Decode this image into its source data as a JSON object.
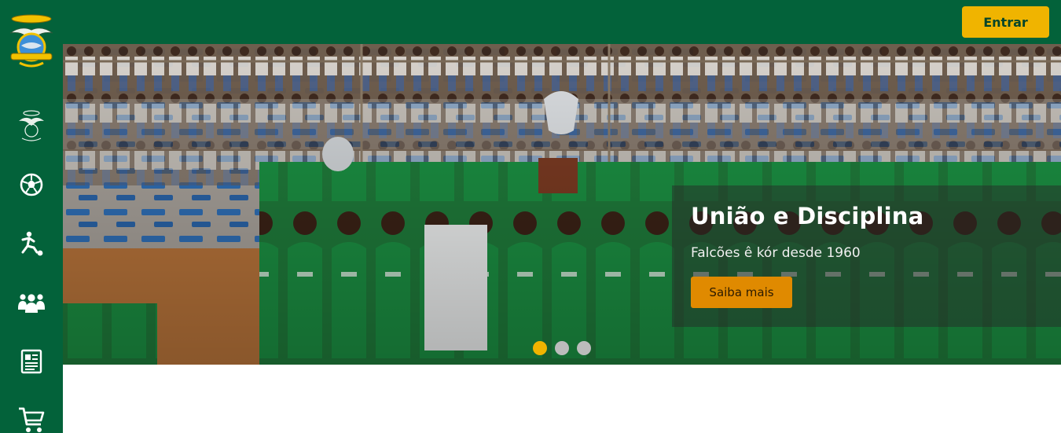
{
  "header": {
    "login_label": "Entrar"
  },
  "sidebar": {
    "logo_icon": "club-crest-icon",
    "items": [
      {
        "name": "club",
        "icon": "club-emblem-icon"
      },
      {
        "name": "football",
        "icon": "soccer-ball-icon"
      },
      {
        "name": "sports",
        "icon": "player-kick-icon"
      },
      {
        "name": "members",
        "icon": "group-people-icon"
      },
      {
        "name": "news",
        "icon": "newspaper-icon"
      },
      {
        "name": "shop",
        "icon": "shopping-cart-icon"
      }
    ]
  },
  "hero": {
    "title": "União e Disciplina",
    "subtitle": "Falcões ê kór desde 1960",
    "cta_label": "Saiba mais",
    "slides_total": 3,
    "active_slide": 1
  },
  "colors": {
    "brand_green": "#03623a",
    "accent_yellow": "#f0b400",
    "cta_orange": "#e08a00",
    "dot_active": "#f0b400",
    "dot_inactive": "#bcbcbc"
  }
}
